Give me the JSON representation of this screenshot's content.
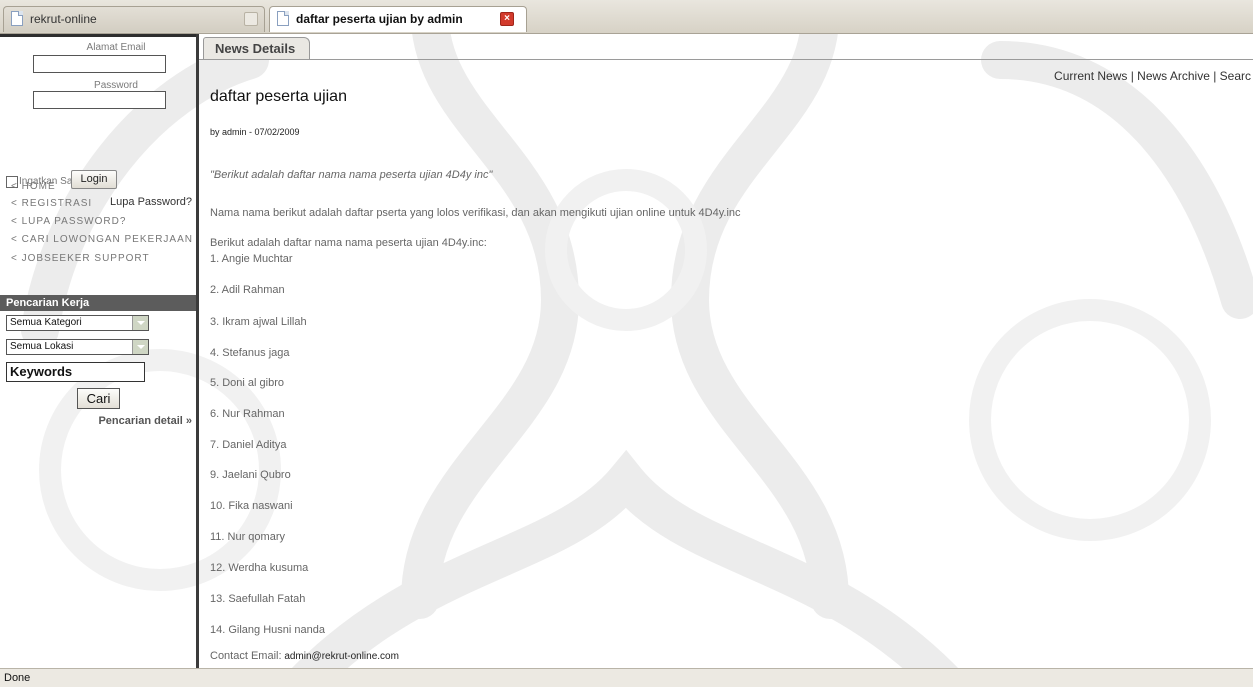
{
  "browser": {
    "tabs": [
      {
        "label": "rekrut-online"
      },
      {
        "label": "daftar peserta ujian by admin"
      }
    ],
    "status": "Done"
  },
  "sidebar": {
    "email_label": "Alamat Email",
    "password_label": "Password",
    "remember_label": "Ingatkan Saya",
    "login_label": "Login",
    "forgot_label": "Lupa Password?",
    "nav": [
      {
        "label": "< HOME"
      },
      {
        "label": "< REGISTRASI"
      },
      {
        "label": "< LUPA PASSWORD?"
      },
      {
        "label": "< CARI LOWONGAN PEKERJAAN"
      },
      {
        "label": "< JOBSEEKER SUPPORT"
      }
    ],
    "search": {
      "header": "Pencarian Kerja",
      "category": "Semua Kategori",
      "location": "Semua Lokasi",
      "keywords": "Keywords",
      "submit_label": "Cari",
      "detail_label": "Pencarian detail »"
    }
  },
  "main": {
    "tab_label": "News Details",
    "top_links": "Current News | News Archive | Searc",
    "title": "daftar peserta ujian",
    "byline": "by admin - 07/02/2009",
    "intro": "\"Berikut adalah daftar nama nama peserta ujian 4D4y inc\"",
    "description": "Nama nama berikut adalah daftar pserta yang lolos verifikasi, dan akan mengikuti ujian online untuk 4D4y.inc",
    "list_heading": "Berikut adalah daftar nama nama peserta ujian 4D4y.inc:",
    "participants": [
      "1. Angie Muchtar",
      "2. Adil Rahman",
      "3. Ikram ajwal Lillah",
      "4. Stefanus jaga",
      "5. Doni al gibro",
      "6. Nur Rahman",
      "7. Daniel Aditya",
      "9. Jaelani Qubro",
      "10. Fika naswani",
      "11. Nur qomary",
      "12. Werdha kusuma",
      "13. Saefullah Fatah",
      "14. Gilang Husni nanda"
    ],
    "contact_label": "Contact Email:",
    "contact_email": "admin@rekrut-online.com"
  }
}
